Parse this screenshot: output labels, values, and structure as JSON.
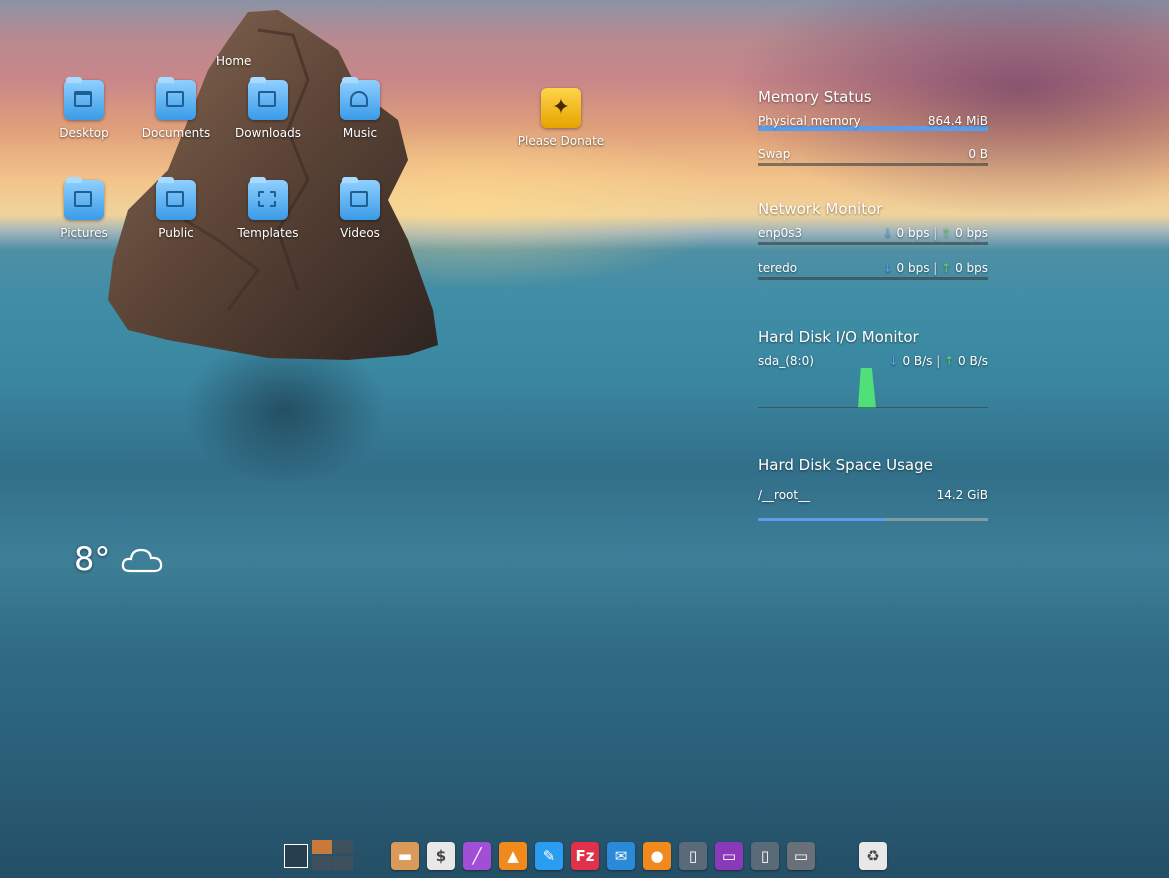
{
  "desktop": {
    "home_label": "Home",
    "icons": [
      {
        "label": "Desktop",
        "icon": "desktop-folder-icon"
      },
      {
        "label": "Documents",
        "icon": "documents-folder-icon"
      },
      {
        "label": "Downloads",
        "icon": "downloads-folder-icon"
      },
      {
        "label": "Music",
        "icon": "music-folder-icon"
      },
      {
        "label": "Pictures",
        "icon": "pictures-folder-icon"
      },
      {
        "label": "Public",
        "icon": "public-folder-icon"
      },
      {
        "label": "Templates",
        "icon": "templates-folder-icon"
      },
      {
        "label": "Videos",
        "icon": "videos-folder-icon"
      }
    ],
    "donate": {
      "label": "Please Donate",
      "icon": "compass-star-icon"
    }
  },
  "widgets": {
    "memory": {
      "title": "Memory Status",
      "physical_label": "Physical memory",
      "physical_value": "864.4 MiB",
      "physical_fraction": 1.0,
      "swap_label": "Swap",
      "swap_value": "0 B",
      "swap_fraction": 0
    },
    "network": {
      "title": "Network Monitor",
      "interfaces": [
        {
          "name": "enp0s3",
          "down": "0 bps",
          "up": "0 bps"
        },
        {
          "name": "teredo",
          "down": "0 bps",
          "up": "0 bps"
        }
      ]
    },
    "disk_io": {
      "title": "Hard Disk I/O Monitor",
      "device": "sda_(8:0)",
      "read": "0 B/s",
      "write": "0 B/s"
    },
    "disk_space": {
      "title": "Hard Disk Space Usage",
      "mount": "/__root__",
      "used": "14.2 GiB",
      "used_fraction": 0.55
    }
  },
  "weather": {
    "temperature": "8°",
    "condition_icon": "cloud-icon"
  },
  "dock": {
    "items": [
      {
        "icon": "file-manager-icon",
        "color": "#d99a5a"
      },
      {
        "icon": "terminal-icon",
        "color": "#e8e8e8"
      },
      {
        "icon": "paint-brush-icon",
        "color": "#a24fd8"
      },
      {
        "icon": "vlc-cone-icon",
        "color": "#f08a1c"
      },
      {
        "icon": "text-editor-icon",
        "color": "#2a9df0"
      },
      {
        "icon": "filezilla-icon",
        "color": "#e0304a"
      },
      {
        "icon": "mail-icon",
        "color": "#2a8ad8"
      },
      {
        "icon": "firefox-icon",
        "color": "#f08a1c"
      },
      {
        "icon": "document-icon",
        "color": "#5a6a78"
      },
      {
        "icon": "chat-icon",
        "color": "#8a3ab8"
      },
      {
        "icon": "document-edit-icon",
        "color": "#5a6a78"
      },
      {
        "icon": "usb-drive-icon",
        "color": "#6a7078"
      },
      {
        "icon": "recycle-bin-icon",
        "color": "#e8e8e8"
      }
    ]
  }
}
